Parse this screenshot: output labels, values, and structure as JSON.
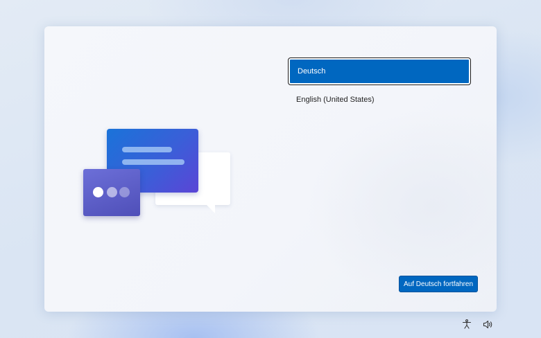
{
  "languages": {
    "items": [
      {
        "label": "Deutsch",
        "selected": true
      },
      {
        "label": "English (United States)",
        "selected": false
      }
    ]
  },
  "actions": {
    "continue_label": "Auf Deutsch fortfahren"
  },
  "system_tray": {
    "icons": [
      "accessibility-icon",
      "volume-icon"
    ]
  },
  "colors": {
    "accent": "#0067c0",
    "card_background": "#f4f6fa"
  }
}
